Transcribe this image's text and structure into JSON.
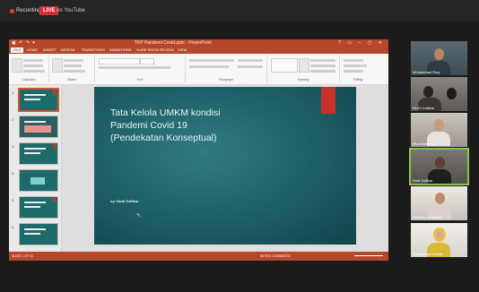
{
  "recording": {
    "label": "Recording",
    "live_badge": "LIVE",
    "platform": "on YouTube"
  },
  "app": {
    "doc_title": "TKP Pandemi Covid.pptx - PowerPoint"
  },
  "ribbon_tabs": [
    "FILE",
    "HOME",
    "INSERT",
    "DESIGN",
    "TRANSITIONS",
    "ANIMATIONS",
    "SLIDE SHOW",
    "REVIEW",
    "VIEW"
  ],
  "ribbon_groups": [
    "Clipboard",
    "Slides",
    "Font",
    "Paragraph",
    "Drawing",
    "Editing"
  ],
  "slides": [
    {
      "number": "1"
    },
    {
      "number": "2"
    },
    {
      "number": "3"
    },
    {
      "number": "4"
    },
    {
      "number": "5"
    },
    {
      "number": "6"
    }
  ],
  "current_slide": {
    "title": "Tata Kelola UMKM  kondisi\nPandemi Covid 19\n(Pendekatan Konseptual)",
    "author": "by: Rudi Zulfikar"
  },
  "status_bar": {
    "slide_info": "SLIDE 1 OF 10",
    "view_label": "NOTES   COMMENTS"
  },
  "participants": [
    {
      "name": "Muhammad Rizq"
    },
    {
      "name": "RUDI Zulfikar"
    },
    {
      "name": "Mira Rahmani"
    },
    {
      "name": "Rudi Zulfikar"
    },
    {
      "name": "Mahenyra Puspita"
    },
    {
      "name": "Nurlaelasari Helda"
    }
  ],
  "colors": {
    "ppt_accent": "#b7472a",
    "live_red": "#d32f2f",
    "active_speaker": "#8bc34a",
    "slide_teal": "#1d5e65"
  }
}
